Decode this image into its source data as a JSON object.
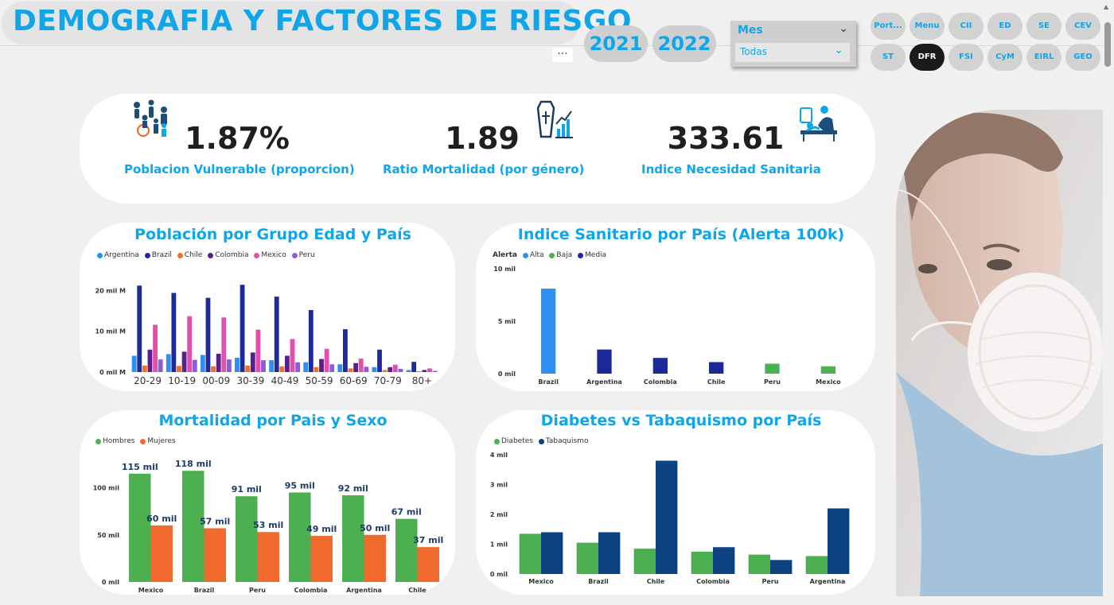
{
  "header": {
    "title": "DEMOGRAFIA Y FACTORES DE RIESGO",
    "more_label": "···",
    "years": [
      "2021",
      "2022"
    ],
    "slicer": {
      "label": "Mes",
      "value": "Todas"
    },
    "nav": {
      "row1": [
        "Port...",
        "Menu",
        "CII",
        "ED",
        "SE",
        "CEV"
      ],
      "row2": [
        "ST",
        "DFR",
        "FSI",
        "CyM",
        "EIRL",
        "GEO"
      ],
      "active": "DFR"
    }
  },
  "kpis": [
    {
      "value": "1.87%",
      "label": "Poblacion Vulnerable (proporcion)",
      "icon": "people-icon"
    },
    {
      "value": "1.89",
      "label": "Ratio Mortalidad (por género)",
      "icon": "coffin-chart-icon"
    },
    {
      "value": "333.61",
      "label": "Indice Necesidad Sanitaria",
      "icon": "doctor-patient-icon"
    }
  ],
  "colors": {
    "accent": "#0ea5e9",
    "Argentina": "#2e8ff0",
    "Brazil": "#1e2a9a",
    "Chile": "#f07024",
    "Colombia": "#5b1f8c",
    "Mexico": "#e24fae",
    "Peru": "#8a5fd6",
    "Alta": "#2e8ff0",
    "Baja": "#4caf50",
    "Media": "#1a2898",
    "Hombres": "#4caf50",
    "Mujeres": "#ef6a2c",
    "Diabetes": "#4caf50",
    "Tabaquismo": "#0d4280"
  },
  "chart_data": [
    {
      "id": "poblacion",
      "type": "bar",
      "title": "Población por Grupo Edad y País",
      "categories": [
        "20-29",
        "10-19",
        "00-09",
        "30-39",
        "40-49",
        "50-59",
        "60-69",
        "70-79",
        "80+"
      ],
      "series": [
        {
          "name": "Argentina",
          "values": [
            4.0,
            4.4,
            4.2,
            3.5,
            2.9,
            2.4,
            1.9,
            1.2,
            0.5
          ]
        },
        {
          "name": "Brazil",
          "values": [
            21.2,
            19.4,
            18.2,
            21.4,
            18.5,
            15.2,
            10.5,
            5.5,
            2.5
          ]
        },
        {
          "name": "Chile",
          "values": [
            1.6,
            1.5,
            1.4,
            1.6,
            1.4,
            1.2,
            0.9,
            0.5,
            0.2
          ]
        },
        {
          "name": "Colombia",
          "values": [
            5.5,
            5.0,
            4.5,
            4.8,
            4.0,
            3.2,
            2.2,
            1.2,
            0.5
          ]
        },
        {
          "name": "Mexico",
          "values": [
            11.6,
            13.7,
            13.4,
            10.4,
            8.1,
            5.7,
            3.3,
            1.8,
            0.9
          ]
        },
        {
          "name": "Peru",
          "values": [
            3.1,
            3.0,
            3.1,
            2.9,
            2.4,
            1.9,
            1.3,
            0.8,
            0.3
          ]
        }
      ],
      "yticks": [
        "0 mil M",
        "10 mil M",
        "20 mil M"
      ],
      "ylim": [
        0,
        23
      ]
    },
    {
      "id": "indice",
      "type": "bar",
      "title": "Indice Sanitario por País (Alerta 100k)",
      "legend_title": "Alerta",
      "legend": [
        "Alta",
        "Baja",
        "Media"
      ],
      "categories": [
        "Brazil",
        "Argentina",
        "Colombia",
        "Chile",
        "Peru",
        "Mexico"
      ],
      "values": [
        8.1,
        2.3,
        1.5,
        1.1,
        0.95,
        0.7
      ],
      "alerta": [
        "Alta",
        "Media",
        "Media",
        "Media",
        "Baja",
        "Baja"
      ],
      "yticks": [
        "0 mil",
        "5 mil",
        "10 mil"
      ],
      "ylim": [
        0,
        10
      ]
    },
    {
      "id": "mortalidad",
      "type": "bar",
      "title": "Mortalidad por Pais y Sexo",
      "categories": [
        "Mexico",
        "Brazil",
        "Peru",
        "Colombia",
        "Argentina",
        "Chile"
      ],
      "series": [
        {
          "name": "Hombres",
          "values": [
            115,
            118,
            91,
            95,
            92,
            67
          ],
          "labels": [
            "115 mil",
            "118 mil",
            "91 mil",
            "95 mil",
            "92 mil",
            "67 mil"
          ]
        },
        {
          "name": "Mujeres",
          "values": [
            60,
            57,
            53,
            49,
            50,
            37
          ],
          "labels": [
            "60 mil",
            "57 mil",
            "53 mil",
            "49 mil",
            "50 mil",
            "37 mil"
          ]
        }
      ],
      "yticks": [
        "0 mil",
        "50 mil",
        "100 mil"
      ],
      "ylim": [
        0,
        130
      ]
    },
    {
      "id": "diabetes",
      "type": "bar",
      "title": "Diabetes vs Tabaquismo por País",
      "categories": [
        "Mexico",
        "Brazil",
        "Chile",
        "Colombia",
        "Peru",
        "Argentina"
      ],
      "series": [
        {
          "name": "Diabetes",
          "values": [
            1.35,
            1.05,
            0.85,
            0.75,
            0.65,
            0.6
          ]
        },
        {
          "name": "Tabaquismo",
          "values": [
            1.4,
            1.4,
            3.8,
            0.9,
            0.47,
            2.2
          ]
        }
      ],
      "yticks": [
        "0 mil",
        "1 mil",
        "2 mil",
        "3 mil",
        "4 mil"
      ],
      "ylim": [
        0,
        4
      ]
    }
  ]
}
